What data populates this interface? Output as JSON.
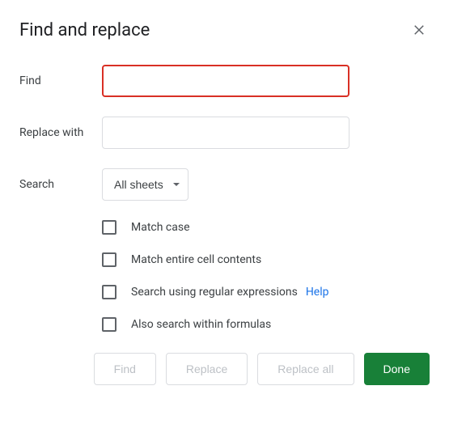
{
  "dialog": {
    "title": "Find and replace",
    "labels": {
      "find": "Find",
      "replace_with": "Replace with",
      "search": "Search"
    },
    "inputs": {
      "find_value": "",
      "replace_value": ""
    },
    "search_scope": {
      "selected": "All sheets"
    },
    "options": {
      "match_case": "Match case",
      "match_entire": "Match entire cell contents",
      "regex": "Search using regular expressions",
      "regex_help": "Help",
      "within_formulas": "Also search within formulas"
    },
    "buttons": {
      "find": "Find",
      "replace": "Replace",
      "replace_all": "Replace all",
      "done": "Done"
    }
  }
}
